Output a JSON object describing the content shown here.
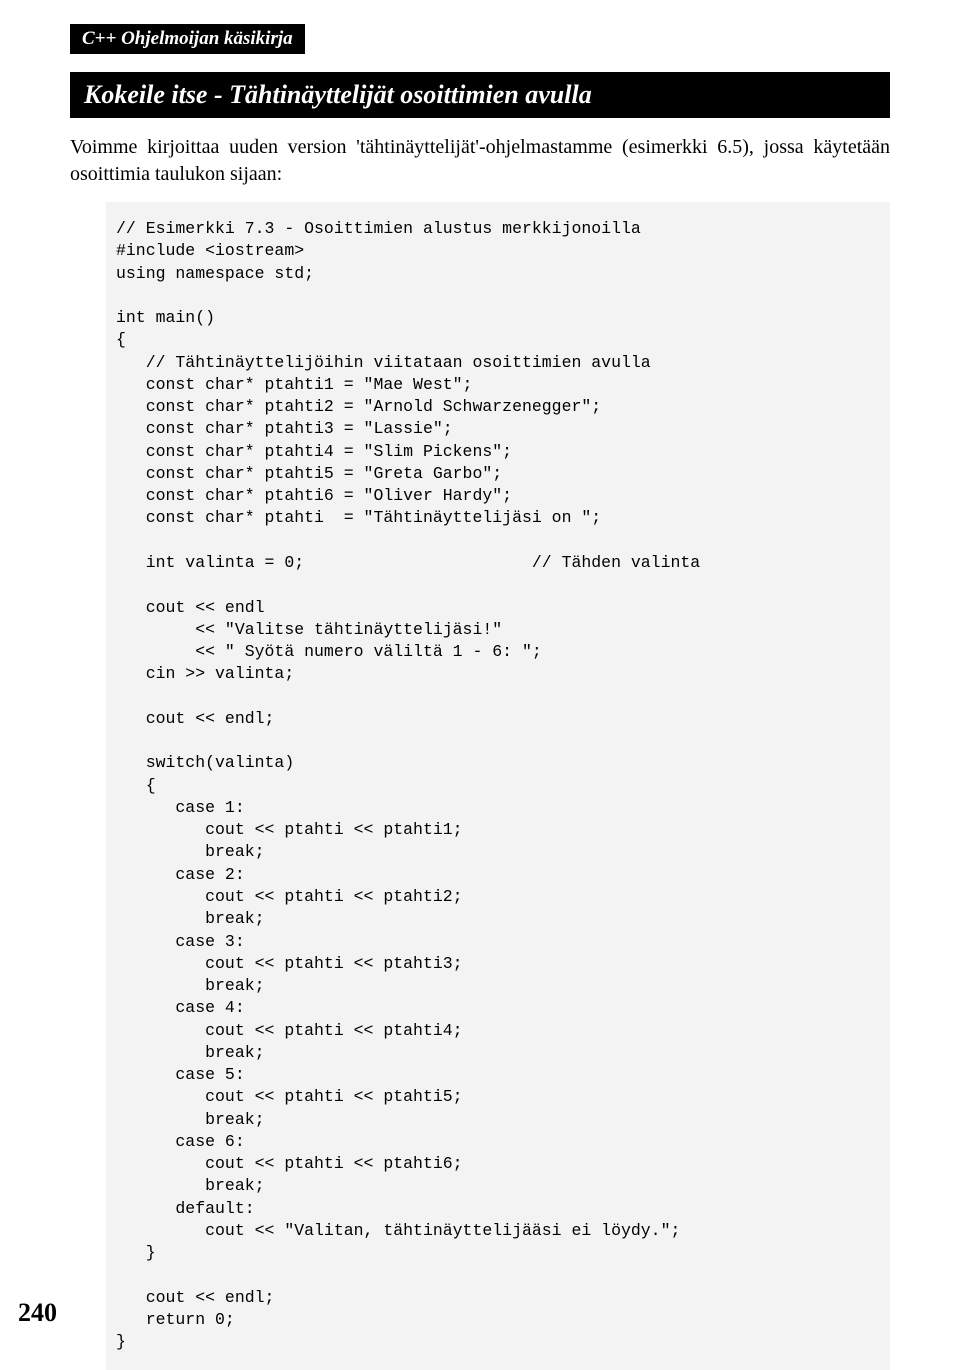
{
  "book_label": "C++ Ohjelmoijan käsikirja",
  "section_title": "Kokeile itse - Tähtinäyttelijät osoittimien avulla",
  "intro": "Voimme kirjoittaa uuden version 'tähtinäyttelijät'-ohjelmastamme (esimerkki 6.5), jossa käytetään osoittimia taulukon sijaan:",
  "code": "// Esimerkki 7.3 - Osoittimien alustus merkkijonoilla\n#include <iostream>\nusing namespace std;\n\nint main()\n{\n   // Tähtinäyttelijöihin viitataan osoittimien avulla\n   const char* ptahti1 = \"Mae West\";\n   const char* ptahti2 = \"Arnold Schwarzenegger\";\n   const char* ptahti3 = \"Lassie\";\n   const char* ptahti4 = \"Slim Pickens\";\n   const char* ptahti5 = \"Greta Garbo\";\n   const char* ptahti6 = \"Oliver Hardy\";\n   const char* ptahti  = \"Tähtinäyttelijäsi on \";\n\n   int valinta = 0;                       // Tähden valinta\n\n   cout << endl\n        << \"Valitse tähtinäyttelijäsi!\"\n        << \" Syötä numero väliltä 1 - 6: \";\n   cin >> valinta;\n\n   cout << endl;\n\n   switch(valinta)\n   {\n      case 1:\n         cout << ptahti << ptahti1;\n         break;\n      case 2:\n         cout << ptahti << ptahti2;\n         break;\n      case 3:\n         cout << ptahti << ptahti3;\n         break;\n      case 4:\n         cout << ptahti << ptahti4;\n         break;\n      case 5:\n         cout << ptahti << ptahti5;\n         break;\n      case 6:\n         cout << ptahti << ptahti6;\n         break;\n      default:\n         cout << \"Valitan, tähtinäyttelijääsi ei löydy.\";\n   }\n\n   cout << endl;\n   return 0;\n}",
  "page_number": "240"
}
